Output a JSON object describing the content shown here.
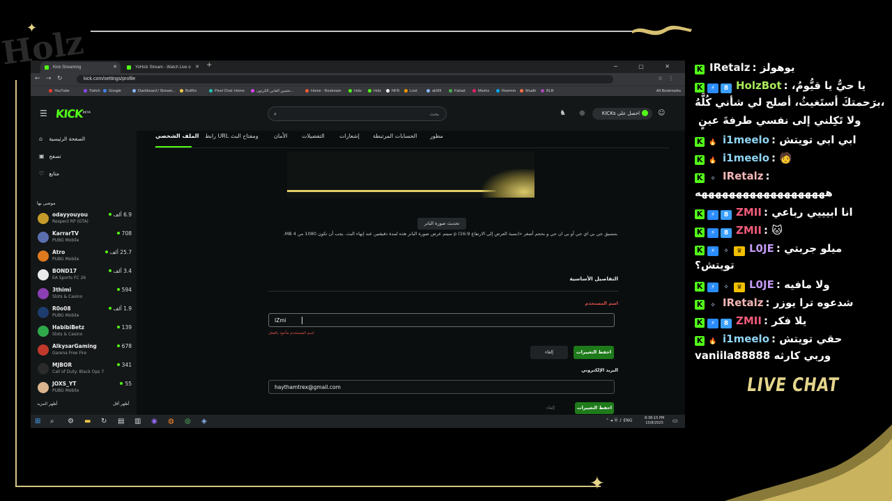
{
  "colors": {
    "kick_green": "#53fc18",
    "gold": "#e4d58c",
    "save_green": "#1e7a1a",
    "error_red": "#e0524a"
  },
  "overlay": {
    "logo_text": "Holz",
    "live_chat": "LIVE CHAT"
  },
  "browser": {
    "tabs": [
      {
        "label": "Kick Streaming",
        "favicon": "kick-icon"
      },
      {
        "label": "YoHolz Stream - Watch Live o",
        "favicon": "kick-icon"
      }
    ],
    "url": "kick.com/settings/profile",
    "bookmarks": [
      "YouTube",
      "Twitch",
      "Google",
      "Dashboard / Stream...",
      "BotRix",
      "Pixel Chat: Home",
      "تخمين العابي الكرتون...",
      "Home - Restream",
      "Holz",
      "Holz",
      "NFR",
      "Loot",
      "ak90l",
      "Fahad",
      "Meshz",
      "Rwemm",
      "Muath",
      "BLB"
    ],
    "all_bookmarks": "All Bookmarks"
  },
  "kick": {
    "search_placeholder": "بحث",
    "get_kicks": "احصل على KICKs",
    "nav": [
      {
        "label": "الصفحة الرئيسية",
        "icon": "home-icon"
      },
      {
        "label": "تصفح",
        "icon": "browse-icon"
      },
      {
        "label": "متابع",
        "icon": "heart-icon"
      }
    ],
    "recommended_title": "موصى بها",
    "channels": [
      {
        "name": "odayyouyou",
        "game": "Respect RP (GTA)",
        "viewers": "6.9 ألف",
        "color": "#c49b2a"
      },
      {
        "name": "KarrarTV",
        "game": "PUBG Mobile",
        "viewers": "708",
        "color": "#5b6fb0"
      },
      {
        "name": "Atro",
        "game": "PUBG Mobile",
        "viewers": "25.7 ألف",
        "color": "#e07a1e"
      },
      {
        "name": "BOND17",
        "game": "EA Sports FC 26",
        "viewers": "3.4 ألف",
        "color": "#eaeaea"
      },
      {
        "name": "3thimi",
        "game": "Slots & Casino",
        "viewers": "594",
        "color": "#8a3fb3"
      },
      {
        "name": "R0o08",
        "game": "PUBG Mobile",
        "viewers": "1.9 ألف",
        "color": "#1e3c6e"
      },
      {
        "name": "HabibiBetz",
        "game": "Slots & Casino",
        "viewers": "139",
        "color": "#2fa84a"
      },
      {
        "name": "AlkysarGaming",
        "game": "Garena Free Fire",
        "viewers": "678",
        "color": "#c0392b"
      },
      {
        "name": "MJBOR",
        "game": "Call of Duty: Black Ops 7",
        "viewers": "341",
        "color": "#2b2b2b"
      },
      {
        "name": "JOXS_YT",
        "game": "PUBG Mobile",
        "viewers": "55",
        "color": "#d9b48f"
      }
    ],
    "show_more": "أظهر المزيد",
    "show_less": "أظهر أقل",
    "settings_tabs": [
      "الملف الشخصي",
      "رابط URL ومفتاح البث",
      "الأمان",
      "التفضيلات",
      "إشعارات",
      "الحسابات المرتبطة",
      "مطور"
    ],
    "update_banner": "تحديث صورة البانر",
    "banner_note": "بتنسيق جي بي اي جي أو بي ان جي و بحجم أصغر «(نسبة العرض إلى الارتفاع 16:9) p سيتم عرض صورة البانر هذه لمدة دقيقتين عند إنهاء البث. يجب أن تكون 1080 من 4 MB.",
    "basic_details": "التفاصيل الأساسية",
    "username_label": "اسم المستخدم",
    "username_value": "IZmi",
    "username_error": "اسم المستخدم مأخوذ بالفعل",
    "cancel": "إلغاء",
    "save": "احفظ التغييرات",
    "email_label": "البريد الإلكتروني",
    "email_value": "haythamtrex@gmail.com"
  },
  "taskbar": {
    "lang": "ENG",
    "time": "8:38:15 PM",
    "date": "10/8/2025"
  },
  "chat": [
    {
      "badges": [
        "kick"
      ],
      "user": "IRetalz",
      "ucolor": "#f2f2f2",
      "text": "يوهولز"
    },
    {
      "badges": [
        "kick",
        "blue",
        "blue2"
      ],
      "user": "HolzBot",
      "ucolor": "#a9ea5a",
      "text": "يا حيُّ يا قيُّومُ، "
    },
    {
      "cont": "برَحمتكَ أستَغيثُ، أصلح لي شأني كُلَّهُ،"
    },
    {
      "cont": "ولا تَكِلني إلى نفسي طرفةَ عينٍ"
    },
    {
      "badges": [
        "kick",
        "flame"
      ],
      "user": "i1meelo",
      "ucolor": "#8fd4f2",
      "text": "ابي ابي تويتش"
    },
    {
      "badges": [
        "kick",
        "flame"
      ],
      "user": "i1meelo",
      "ucolor": "#8fd4f2",
      "text": "🧑"
    },
    {
      "badges": [
        "kick",
        "wings"
      ],
      "user": "IRetalz",
      "ucolor": "#f2b6b6",
      "text": ""
    },
    {
      "cont": "هههههههههههههههههههه"
    },
    {
      "badges": [
        "kick",
        "blue",
        "blue2"
      ],
      "user": "ZMII",
      "ucolor": "#f25a7a",
      "text": "انا ابيييي رباعي"
    },
    {
      "badges": [
        "kick",
        "blue",
        "blue2"
      ],
      "user": "ZMII",
      "ucolor": "#f25a7a",
      "text": "🐱"
    },
    {
      "badges": [
        "kick",
        "blue",
        "wings",
        "crown"
      ],
      "user": "L0JE",
      "ucolor": "#c29af2",
      "text": "ميلو جربتي"
    },
    {
      "cont": "تويتش؟"
    },
    {
      "badges": [
        "kick",
        "blue",
        "wings",
        "crown"
      ],
      "user": "L0JE",
      "ucolor": "#c29af2",
      "text": "ولا مافيه"
    },
    {
      "badges": [
        "kick",
        "wings"
      ],
      "user": "IRetalz",
      "ucolor": "#f2b6b6",
      "text": "شدعوه ترا يوزر"
    },
    {
      "badges": [
        "kick",
        "blue",
        "blue2"
      ],
      "user": "ZMII",
      "ucolor": "#f25a7a",
      "text": "يلا فكر"
    },
    {
      "badges": [
        "kick",
        "flame"
      ],
      "user": "i1meelo",
      "ucolor": "#8fd4f2",
      "text": "حقي تويتش"
    },
    {
      "cont": "vaniila88888 وربي كارثه"
    }
  ]
}
